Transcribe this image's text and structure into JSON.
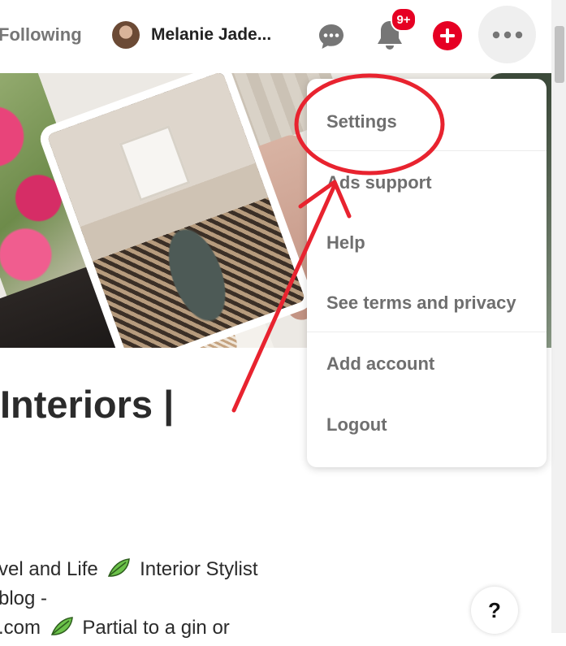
{
  "header": {
    "following_label": "Following",
    "username": "Melanie Jade...",
    "notification_badge": "9+"
  },
  "profile": {
    "title": "Interiors |",
    "bio_lines": [
      "vel and Life",
      "Interior Stylist",
      "blog -",
      ".com",
      "Partial to a gin or"
    ]
  },
  "menu": {
    "items": [
      {
        "label": "Settings"
      },
      {
        "label": "Ads support"
      },
      {
        "label": "Help"
      },
      {
        "label": "See terms and privacy"
      },
      {
        "label": "Add account"
      },
      {
        "label": "Logout"
      }
    ]
  },
  "help_button": {
    "label": "?"
  },
  "colors": {
    "brand_red": "#e60023",
    "annotation_red": "#e8232f",
    "menu_text": "#6f6f6f"
  },
  "icons": [
    "chat-icon",
    "bell-icon",
    "plus-icon",
    "more-icon",
    "leaf-emoji-icon"
  ]
}
